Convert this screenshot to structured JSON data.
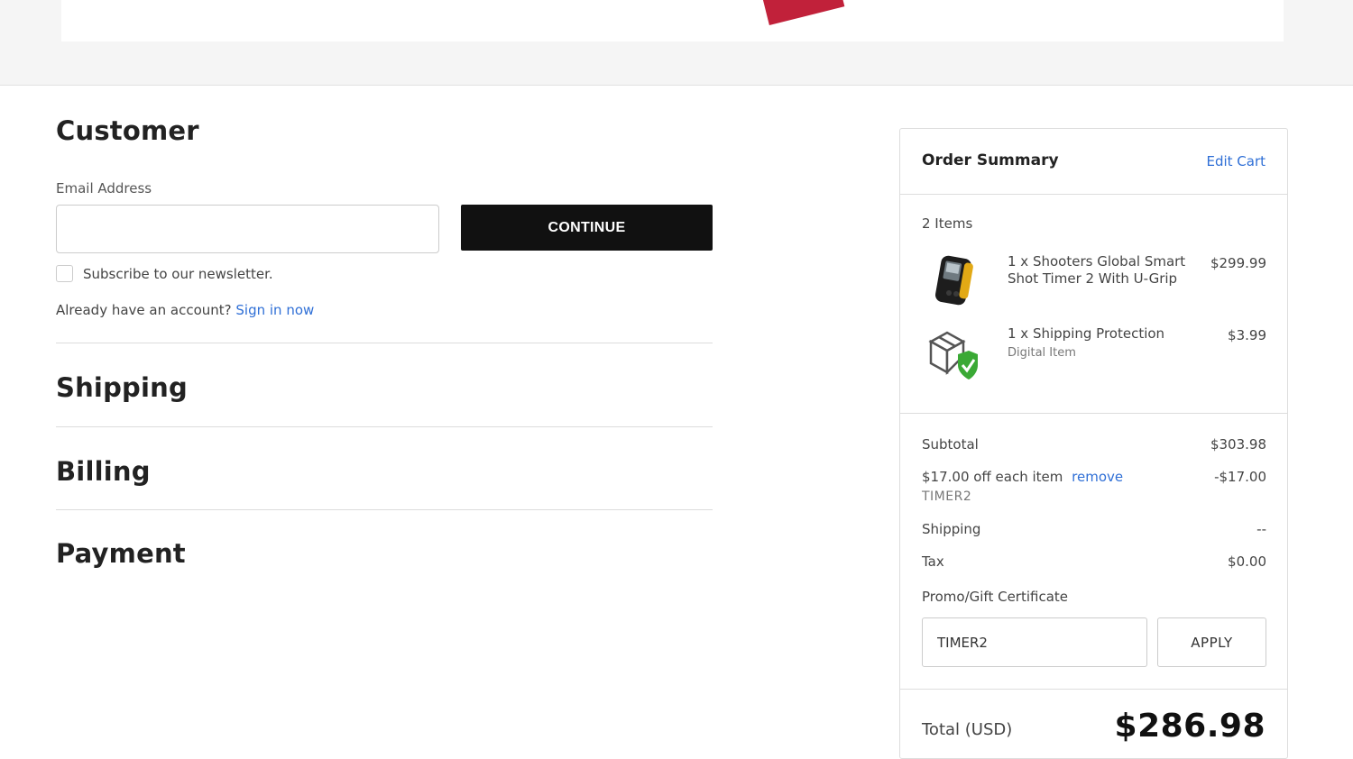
{
  "checkout": {
    "customer_title": "Customer",
    "email_label": "Email Address",
    "email_value": "",
    "continue_label": "CONTINUE",
    "newsletter_label": "Subscribe to our newsletter.",
    "account_prompt": "Already have an account?",
    "sign_in_link": "Sign in now",
    "shipping_title": "Shipping",
    "billing_title": "Billing",
    "payment_title": "Payment"
  },
  "summary": {
    "title": "Order Summary",
    "edit_cart": "Edit Cart",
    "items_count": "2 Items",
    "items": [
      {
        "name": "1 x Shooters Global Smart Shot Timer 2 With U-Grip",
        "sub": "",
        "price": "$299.99",
        "icon": "shot-timer-icon"
      },
      {
        "name": "1 x Shipping Protection",
        "sub": "Digital Item",
        "price": "$3.99",
        "icon": "shipping-protection-icon"
      }
    ],
    "subtotal_label": "Subtotal",
    "subtotal_value": "$303.98",
    "discount_label": "$17.00 off each item",
    "discount_remove": "remove",
    "discount_value": "-$17.00",
    "coupon_code": "TIMER2",
    "shipping_label": "Shipping",
    "shipping_value": "--",
    "tax_label": "Tax",
    "tax_value": "$0.00",
    "promo_label": "Promo/Gift Certificate",
    "promo_value": "TIMER2",
    "apply_label": "APPLY",
    "total_label": "Total (USD)",
    "total_value": "$286.98"
  },
  "colors": {
    "accent_link": "#2f6fd6",
    "button_dark": "#111111",
    "brand_red": "#c1213a",
    "check_green": "#3aa935"
  }
}
